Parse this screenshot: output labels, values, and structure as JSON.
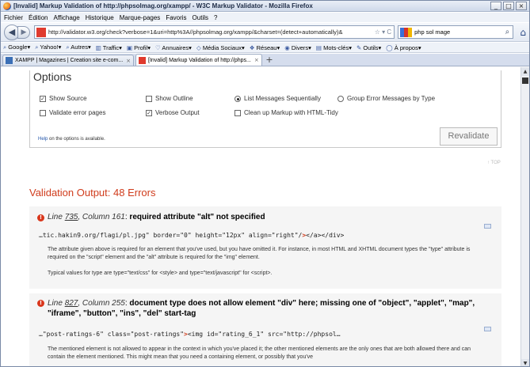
{
  "window": {
    "title": "[Invalid] Markup Validation of http://phpsolmag.org/xampp/ - W3C Markup Validator - Mozilla Firefox",
    "controls": [
      "_",
      "□",
      "×"
    ]
  },
  "menu": [
    "Fichier",
    "Édition",
    "Affichage",
    "Historique",
    "Marque-pages",
    "Favoris",
    "Outils",
    "?"
  ],
  "nav": {
    "back": "◀",
    "forward": "▶",
    "url": "http://validator.w3.org/check?verbose=1&uri=http%3A//phpsolmag.org/xampp/&charset=(detect+automatically)&",
    "url_extras": "☆ ▾ C",
    "search_text": "php sol mage",
    "search_icon": "search-icon",
    "home": "⌂"
  },
  "bookmarks": [
    {
      "icon": "google-icon",
      "label": "Google▾"
    },
    {
      "icon": "yahoo-icon",
      "label": "Yahoo!▾"
    },
    {
      "icon": "autres-icon",
      "label": "Autres▾"
    },
    {
      "icon": "traffic-icon",
      "label": "Traffic▾"
    },
    {
      "icon": "profil-icon",
      "label": "Profil▾"
    },
    {
      "icon": "annuaires-icon",
      "label": "Annuaires▾"
    },
    {
      "icon": "media-icon",
      "label": "Média Sociaux▾"
    },
    {
      "icon": "reseau-icon",
      "label": "Réseau▾"
    },
    {
      "icon": "divers-icon",
      "label": "Divers▾"
    },
    {
      "icon": "motscles-icon",
      "label": "Mots-clés▾"
    },
    {
      "icon": "outils-icon",
      "label": "Outils▾"
    },
    {
      "icon": "apropos-icon",
      "label": "À propos▾"
    }
  ],
  "tabs": [
    {
      "label": "XAMPP | Magazines | Creation site e-com...",
      "close": "×",
      "active": false,
      "color": "#3b6fb6"
    },
    {
      "label": "[Invalid] Markup Validation of http://phps...",
      "close": "×",
      "active": true,
      "color": "#e03b2e"
    }
  ],
  "new_tab": "+",
  "options": {
    "heading": "Options",
    "show_source": "Show Source",
    "show_outline": "Show Outline",
    "list_sequential": "List Messages Sequentially",
    "group_by_type": "Group Error Messages by Type",
    "validate_error_pages": "Validate error pages",
    "verbose_output": "Verbose Output",
    "cleanup": "Clean up Markup with HTML-Tidy",
    "help_link": "Help",
    "help_rest": "on the options is available.",
    "revalidate": "Revalidate",
    "checkmark": "✓"
  },
  "top_link": "↑ TOP",
  "validation_heading": "Validation Output: 48 Errors",
  "messages": [
    {
      "icon": "!",
      "line_label": "Line",
      "line": "735",
      "col_label": ", Column",
      "col": "161",
      "text": "required attribute \"alt\" not specified",
      "code_pre": "…tic.hakin9.org/flagi/pl.jpg\" border=\"0\" height=\"12px\" align=\"right\"/",
      "code_hl": ">",
      "code_post": "</a></div>",
      "desc1": "The attribute given above is required for an element that you've used, but you have omitted it. For instance, in most HTML and XHTML document types the \"type\" attribute is required on the \"script\" element and the \"alt\" attribute is required for the \"img\" element.",
      "desc2": "Typical values for type are type=\"text/css\" for <style> and type=\"text/javascript\" for <script>."
    },
    {
      "icon": "!",
      "line_label": "Line",
      "line": "827",
      "col_label": ", Column",
      "col": "255",
      "text": "document type does not allow element \"div\" here; missing one of \"object\", \"applet\", \"map\", \"iframe\", \"button\", \"ins\", \"del\" start-tag",
      "code_pre": "…\"post-ratings-6\" class=\"post-ratings\"",
      "code_hl": ">",
      "code_post": "<img id=\"rating_6_1\" src=\"http://phpsol…",
      "desc1": "The mentioned element is not allowed to appear in the context in which you've placed it; the other mentioned elements are the only ones that are both allowed there and can contain the element mentioned. This might mean that you need a containing element, or possibly that you've"
    }
  ]
}
